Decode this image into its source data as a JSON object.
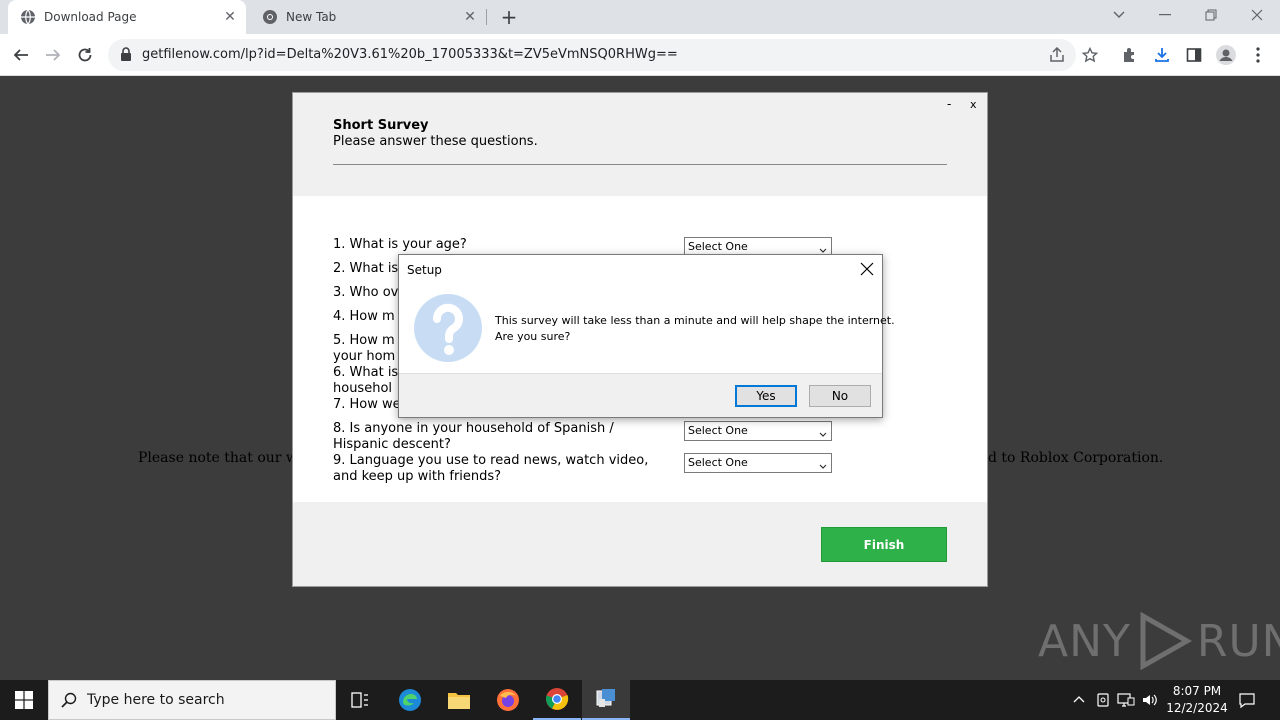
{
  "browser": {
    "tabs": [
      {
        "title": "Download Page",
        "active": true
      },
      {
        "title": "New Tab",
        "active": false
      }
    ],
    "url": "getfilenow.com/lp?id=Delta%20V3.61%20b_17005333&t=ZV5eVmNSQ0RHWg=="
  },
  "page": {
    "notice_left": "Please note that our webs",
    "notice_right": "d to Roblox Corporation."
  },
  "survey": {
    "title": "Short Survey",
    "subtitle": "Please answer these questions.",
    "minimize": "-",
    "close": "x",
    "questions": [
      {
        "text": "1. What is your age?",
        "answer": "Select One"
      },
      {
        "text": "2. What is",
        "answer": ""
      },
      {
        "text": "3. Who ov",
        "answer": ""
      },
      {
        "text": "4. How m",
        "answer": ""
      },
      {
        "text": "5. How m",
        "text2": "your hom",
        "answer": ""
      },
      {
        "text": "6. What is",
        "text2": "househol",
        "answer": ""
      },
      {
        "text": "7. How we",
        "answer": ""
      },
      {
        "text": "8. Is anyone in your household of Spanish /",
        "text2": "Hispanic descent?",
        "answer": "Select One"
      },
      {
        "text": "9. Language you use to read news, watch video,",
        "text2": "and keep up with friends?",
        "answer": "Select One"
      }
    ],
    "finish_label": "Finish"
  },
  "setup_dialog": {
    "title": "Setup",
    "message_line1": "This survey will take less than a minute and will help shape the internet.",
    "message_line2": "Are you sure?",
    "yes_label": "Yes",
    "no_label": "No"
  },
  "watermark": {
    "left": "ANY",
    "right": "RUN"
  },
  "taskbar": {
    "search_placeholder": "Type here to search",
    "time": "8:07 PM",
    "date": "12/2/2024"
  },
  "colors": {
    "finish_green": "#2fb14a",
    "page_bg": "#3c3c3c",
    "taskbar_bg": "#1c1c1c",
    "dialog_accent": "#0078d7"
  }
}
